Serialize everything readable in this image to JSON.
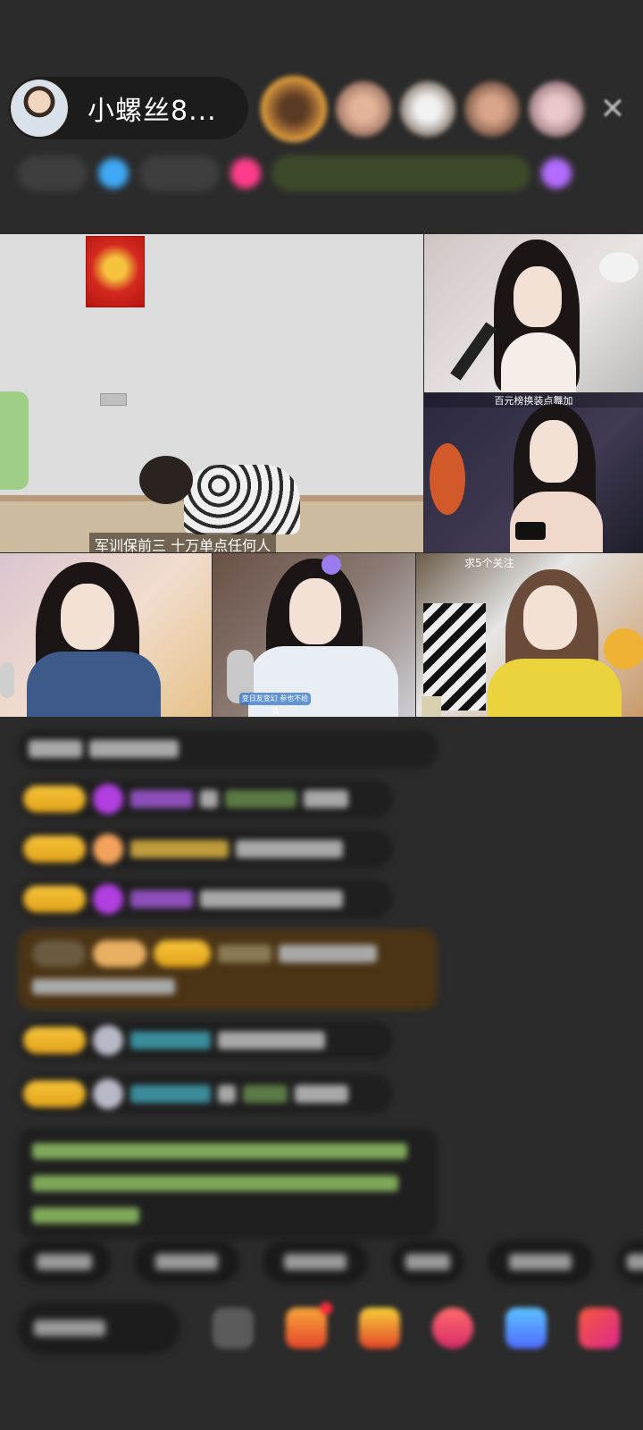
{
  "header": {
    "host_name": "小螺丝8...",
    "viewer_count": 5
  },
  "stream": {
    "main_caption": "军训保前三  十万单点任何人",
    "tile_label_right2": "百元榜换装点舞加",
    "tile_label_bottom3": "求5个关注",
    "mic_tag": "变日友变幻 参也不给钱"
  },
  "chat": {
    "messages": 9
  },
  "quick_replies": {
    "count": 6
  },
  "colors": {
    "background": "#2b2b2b",
    "badge_gold": "#f6c43a",
    "accent_orange": "#e7a33c"
  },
  "icons": [
    "avatar",
    "close-icon",
    "emoji-icon",
    "gift-icon",
    "treasure-box-icon",
    "heart-icon",
    "share-icon",
    "more-grid-icon"
  ]
}
